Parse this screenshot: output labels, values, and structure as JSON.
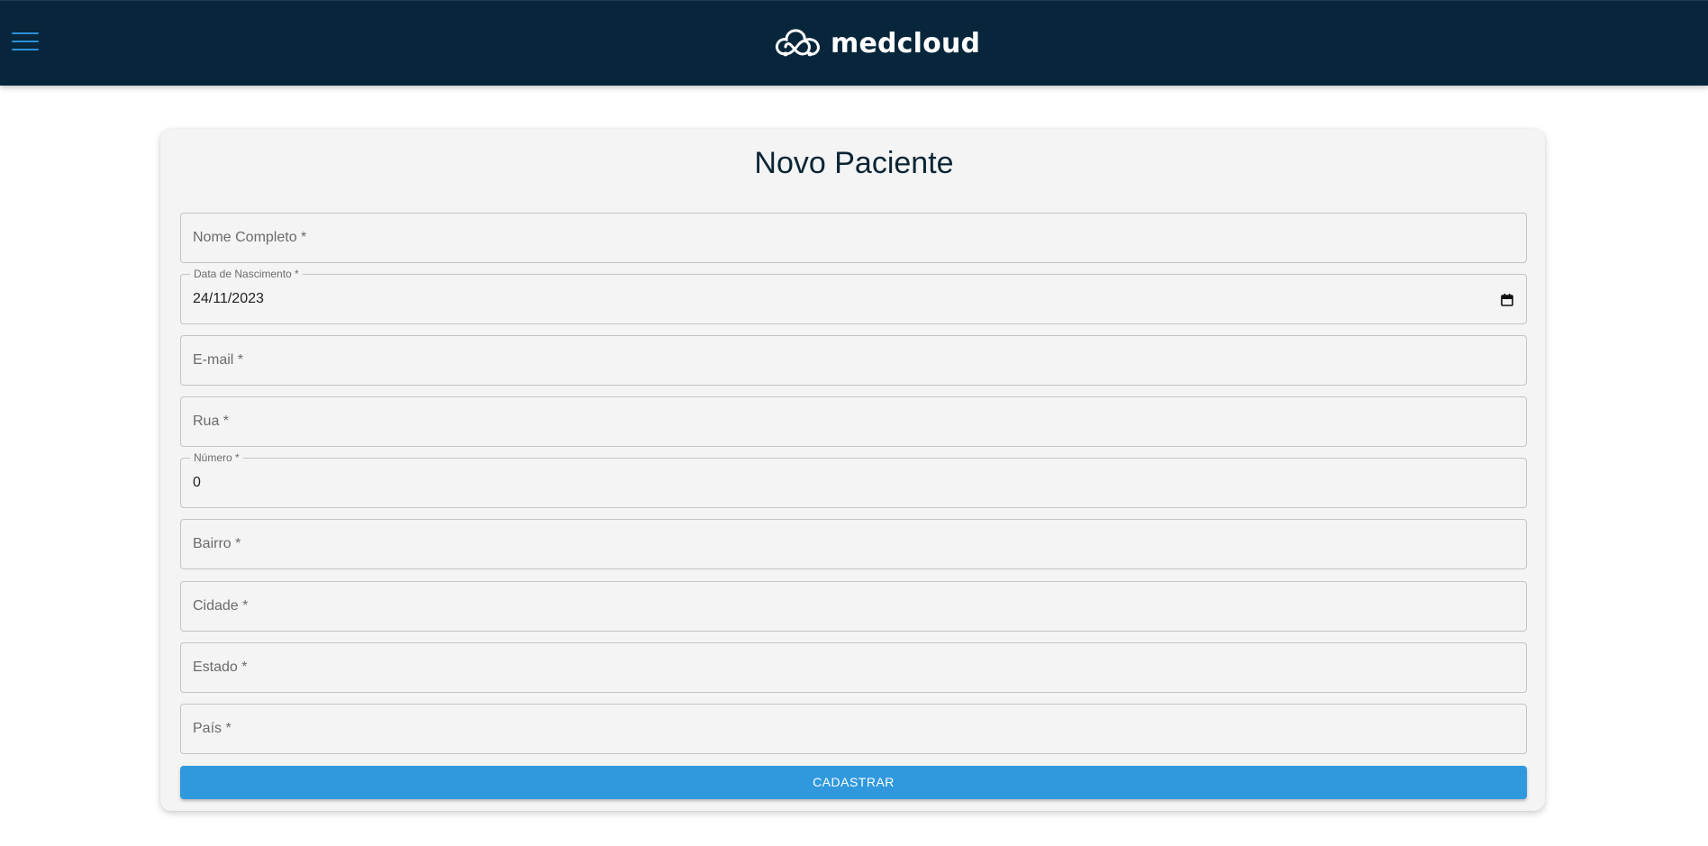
{
  "header": {
    "brand": "medcloud",
    "colors": {
      "bar": "#07263b",
      "menu_icon": "#2d8fd8"
    }
  },
  "form": {
    "title": "Novo Paciente",
    "fields": [
      {
        "label": "Nome Completo *",
        "value": ""
      },
      {
        "label": "Data de Nascimento *",
        "value": "24/11/2023"
      },
      {
        "label": "E-mail *",
        "value": ""
      },
      {
        "label": "Rua *",
        "value": ""
      },
      {
        "label": "Número *",
        "value": "0"
      },
      {
        "label": "Bairro *",
        "value": ""
      },
      {
        "label": "Cidade *",
        "value": ""
      },
      {
        "label": "Estado *",
        "value": ""
      },
      {
        "label": "País *",
        "value": ""
      }
    ],
    "submit_label": "CADASTRAR",
    "colors": {
      "submit": "#3099de",
      "card": "#f4f4f4",
      "title": "#0b2536"
    }
  },
  "icons": [
    "menu-icon",
    "medcloud-logo-icon",
    "calendar-icon"
  ]
}
